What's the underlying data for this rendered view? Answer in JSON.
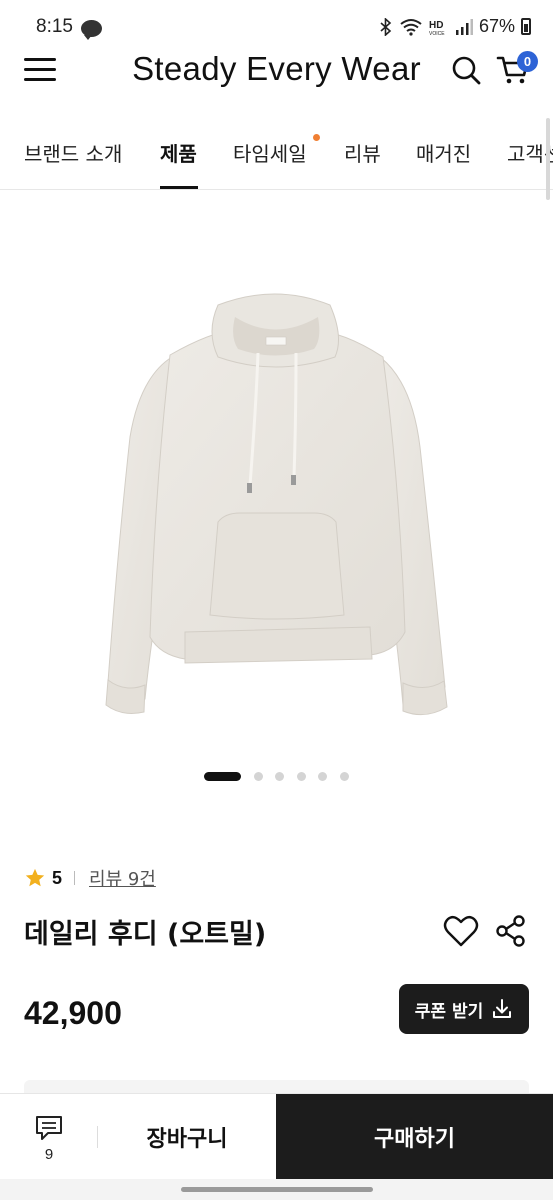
{
  "status_bar": {
    "time": "8:15",
    "notification_icon": "kakaotalk-icon",
    "battery": "67%",
    "icons": [
      "bluetooth-icon",
      "wifi-icon",
      "hd-voice-icon",
      "signal-icon",
      "battery-icon"
    ]
  },
  "header": {
    "brand": "Steady Every Wear",
    "cart_count": "0"
  },
  "nav": {
    "items": [
      {
        "label": "브랜드 소개"
      },
      {
        "label": "제품"
      },
      {
        "label": "타임세일"
      },
      {
        "label": "리뷰"
      },
      {
        "label": "매거진"
      },
      {
        "label": "고객센터"
      }
    ],
    "active_index": 1
  },
  "gallery": {
    "image": "hoodie-oatmeal-image",
    "total_images": 6,
    "active_index": 0
  },
  "product": {
    "rating": "5",
    "review_link": "리뷰 9건",
    "title": "데일리 후디 (오트밀)",
    "price": "42,900",
    "coupon_label": "쿠폰 받기"
  },
  "bottom_bar": {
    "inquiry_count": "9",
    "cart_label": "장바구니",
    "buy_label": "구매하기"
  },
  "colors": {
    "accent_badge": "#2d63d6",
    "nav_dot": "#f07f33",
    "star": "#f2b01e",
    "dark_button": "#1c1c1c"
  }
}
